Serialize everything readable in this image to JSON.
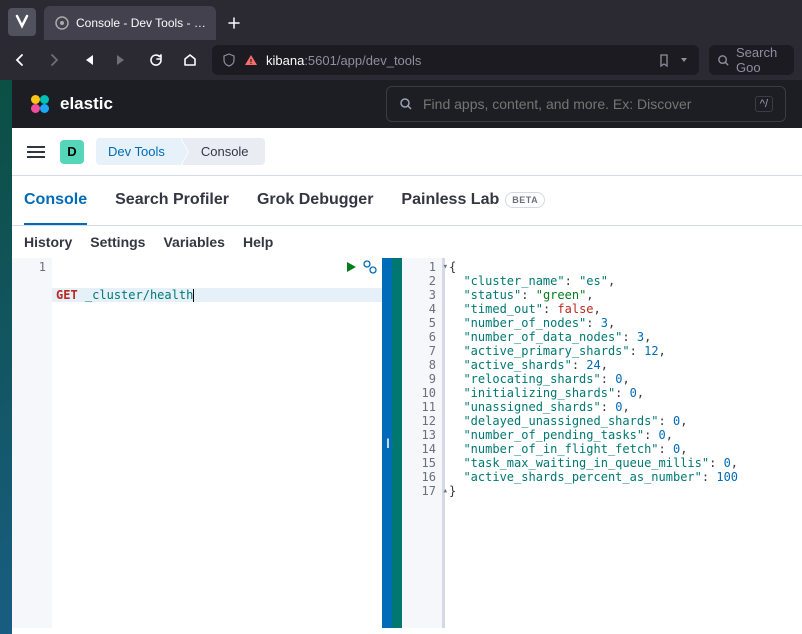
{
  "browser": {
    "tab_title": "Console - Dev Tools - Elasti",
    "url_host": "kibana",
    "url_path": ":5601/app/dev_tools",
    "search_placeholder": "Search Goo"
  },
  "header": {
    "brand": "elastic",
    "search_placeholder": "Find apps, content, and more. Ex: Discover",
    "kbd": "^/"
  },
  "breadcrumbs": {
    "space": "D",
    "item1": "Dev Tools",
    "item2": "Console"
  },
  "tabs": [
    {
      "label": "Console",
      "active": true
    },
    {
      "label": "Search Profiler",
      "active": false
    },
    {
      "label": "Grok Debugger",
      "active": false
    },
    {
      "label": "Painless Lab",
      "active": false,
      "beta": "BETA"
    }
  ],
  "toolbar": [
    "History",
    "Settings",
    "Variables",
    "Help"
  ],
  "request": {
    "lines": [
      "1"
    ],
    "method": "GET",
    "path": "_cluster/health"
  },
  "response": {
    "lines": [
      "1",
      "2",
      "3",
      "4",
      "5",
      "6",
      "7",
      "8",
      "9",
      "10",
      "11",
      "12",
      "13",
      "14",
      "15",
      "16",
      "17"
    ],
    "rows": [
      {
        "t": "open"
      },
      {
        "k": "cluster_name",
        "v": "es",
        "vt": "str"
      },
      {
        "k": "status",
        "v": "green",
        "vt": "str-green"
      },
      {
        "k": "timed_out",
        "v": "false",
        "vt": "bool"
      },
      {
        "k": "number_of_nodes",
        "v": "3",
        "vt": "num"
      },
      {
        "k": "number_of_data_nodes",
        "v": "3",
        "vt": "num"
      },
      {
        "k": "active_primary_shards",
        "v": "12",
        "vt": "num"
      },
      {
        "k": "active_shards",
        "v": "24",
        "vt": "num"
      },
      {
        "k": "relocating_shards",
        "v": "0",
        "vt": "num"
      },
      {
        "k": "initializing_shards",
        "v": "0",
        "vt": "num"
      },
      {
        "k": "unassigned_shards",
        "v": "0",
        "vt": "num"
      },
      {
        "k": "delayed_unassigned_shards",
        "v": "0",
        "vt": "num"
      },
      {
        "k": "number_of_pending_tasks",
        "v": "0",
        "vt": "num"
      },
      {
        "k": "number_of_in_flight_fetch",
        "v": "0",
        "vt": "num"
      },
      {
        "k": "task_max_waiting_in_queue_millis",
        "v": "0",
        "vt": "num"
      },
      {
        "k": "active_shards_percent_as_number",
        "v": "100",
        "vt": "num",
        "last": true
      },
      {
        "t": "close"
      }
    ]
  }
}
